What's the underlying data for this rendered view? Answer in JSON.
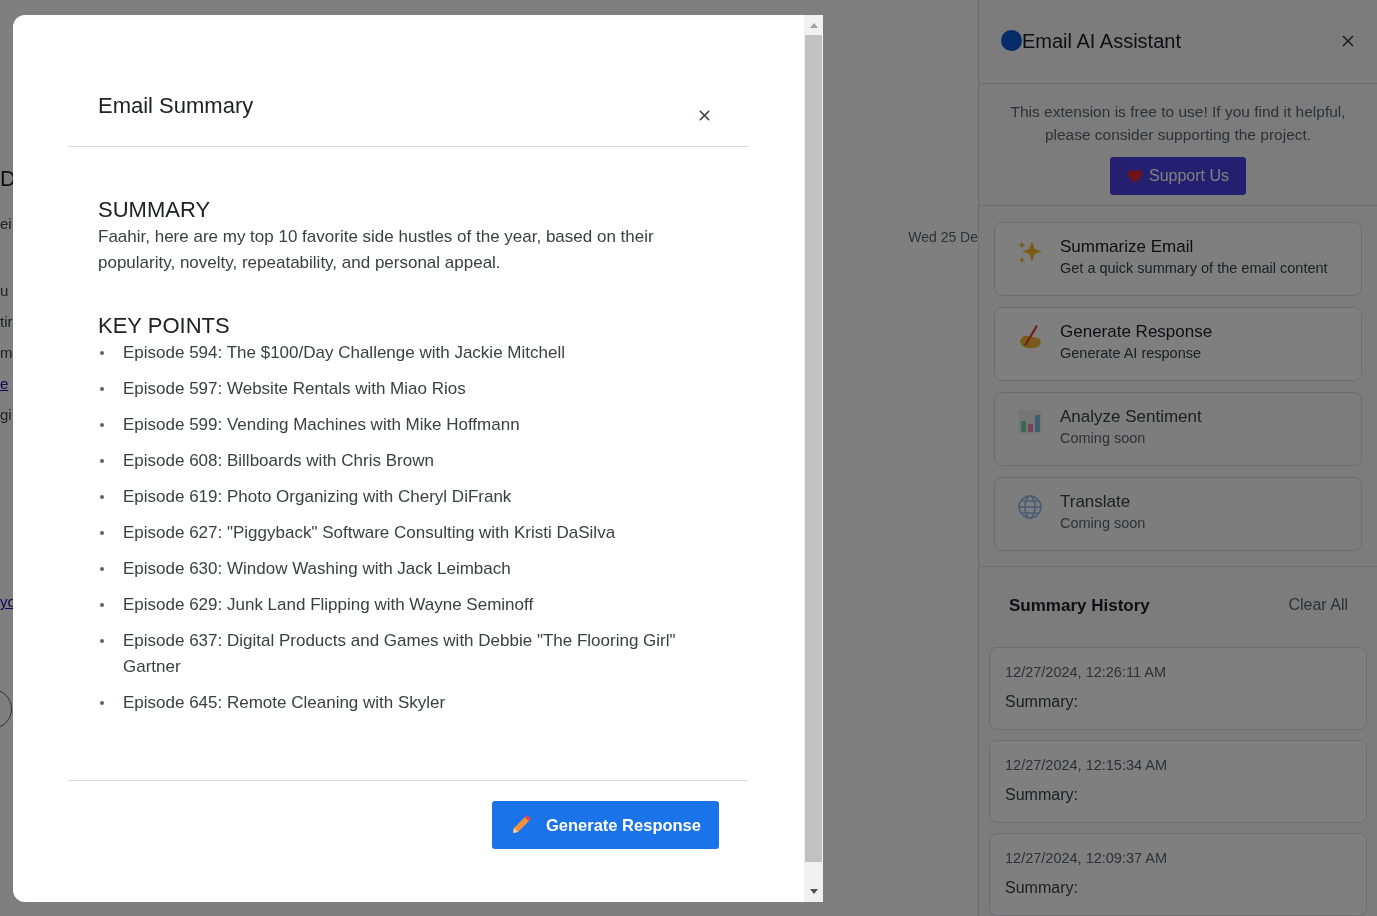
{
  "background_page": {
    "fragments": [
      {
        "text": "D",
        "kind": "heading"
      },
      {
        "text": "ei",
        "kind": "text"
      },
      {
        "text": "u",
        "kind": "text"
      },
      {
        "text": "tir",
        "kind": "text"
      },
      {
        "text": "m",
        "kind": "text"
      },
      {
        "text": "e",
        "kind": "link"
      },
      {
        "text": "gi",
        "kind": "text"
      },
      {
        "text": "yo",
        "kind": "link"
      }
    ],
    "date": "Wed 25 De"
  },
  "modal": {
    "title": "Email Summary",
    "sections": [
      {
        "heading": "SUMMARY",
        "kind": "paragraph",
        "text": "Faahir, here are my top 10 favorite side hustles of the year, based on their popularity, novelty, repeatability, and personal appeal."
      },
      {
        "heading": "KEY POINTS",
        "kind": "list",
        "items": [
          "Episode 594: The $100/Day Challenge with Jackie Mitchell",
          "Episode 597: Website Rentals with Miao Rios",
          "Episode 599: Vending Machines with Mike Hoffmann",
          "Episode 608: Billboards with Chris Brown",
          "Episode 619: Photo Organizing with Cheryl DiFrank",
          "Episode 627: \"Piggyback\" Software Consulting with Kristi DaSilva",
          "Episode 630: Window Washing with Jack Leimbach",
          "Episode 629: Junk Land Flipping with Wayne Seminoff",
          "Episode 637: Digital Products and Games with Debbie \"The Flooring Girl\" Gartner",
          "Episode 645: Remote Cleaning with Skyler"
        ]
      }
    ],
    "button": "Generate Response"
  },
  "sidebar": {
    "title": "Email AI Assistant",
    "notice": "This extension is free to use! If you find it helpful, please consider supporting the project.",
    "support_button": "Support Us",
    "features": [
      {
        "title": "Summarize Email",
        "subtitle": "Get a quick summary of the email content",
        "disabled": false
      },
      {
        "title": "Generate Response",
        "subtitle": "Generate AI response",
        "disabled": false
      },
      {
        "title": "Analyze Sentiment",
        "subtitle": "Coming soon",
        "disabled": true
      },
      {
        "title": "Translate",
        "subtitle": "Coming soon",
        "disabled": true
      }
    ],
    "history": {
      "title": "Summary History",
      "clear_label": "Clear All",
      "entries": [
        {
          "time": "12/27/2024, 12:26:11 AM",
          "label": "Summary:"
        },
        {
          "time": "12/27/2024, 12:15:34 AM",
          "label": "Summary:"
        },
        {
          "time": "12/27/2024, 12:09:37 AM",
          "label": "Summary:"
        }
      ]
    }
  }
}
